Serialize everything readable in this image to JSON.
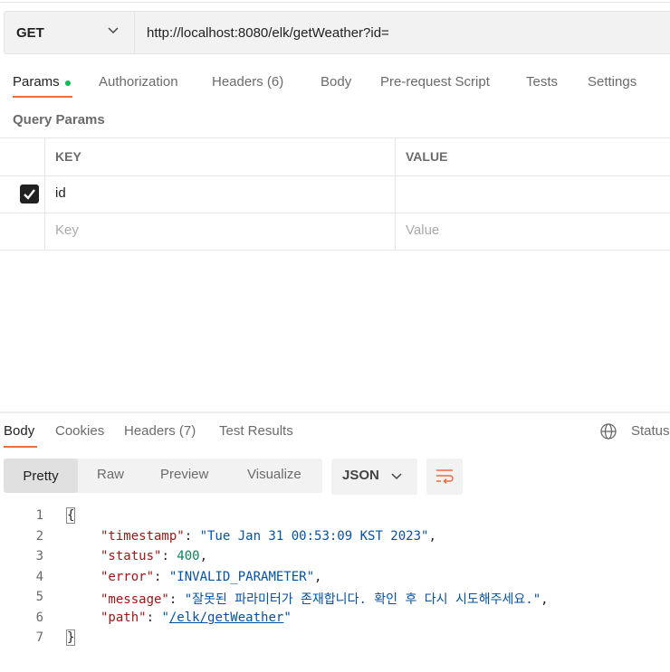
{
  "request": {
    "method": "GET",
    "url": "http://localhost:8080/elk/getWeather?id="
  },
  "request_tabs": [
    {
      "label": "Params"
    },
    {
      "label": "Authorization"
    },
    {
      "label": "Headers (6)"
    },
    {
      "label": "Body"
    },
    {
      "label": "Pre-request Script"
    },
    {
      "label": "Tests"
    },
    {
      "label": "Settings"
    }
  ],
  "query_params": {
    "title": "Query Params",
    "columns": [
      "KEY",
      "VALUE"
    ],
    "rows": [
      {
        "checked": true,
        "key": "id",
        "value": ""
      }
    ],
    "placeholder_key": "Key",
    "placeholder_value": "Value"
  },
  "response_tabs": [
    {
      "label": "Body"
    },
    {
      "label": "Cookies"
    },
    {
      "label": "Headers (7)"
    },
    {
      "label": "Test Results"
    }
  ],
  "status_label": "Status",
  "view_modes": [
    "Pretty",
    "Raw",
    "Preview",
    "Visualize"
  ],
  "format": "JSON",
  "code": {
    "line_numbers": [
      "1",
      "2",
      "3",
      "4",
      "5",
      "6",
      "7"
    ],
    "open_brace": "{",
    "close_brace": "}",
    "fields": [
      {
        "key": "\"timestamp\"",
        "value": "\"Tue Jan 31 00:53:09 KST 2023\"",
        "type": "string"
      },
      {
        "key": "\"status\"",
        "value": "400",
        "type": "number"
      },
      {
        "key": "\"error\"",
        "value": "\"INVALID_PARAMETER\"",
        "type": "string"
      },
      {
        "key": "\"message\"",
        "value": "\"잘못된 파라미터가 존재합니다. 확인 후 다시 시도해주세요.\"",
        "type": "string"
      },
      {
        "key": "\"path\"",
        "value_prefix": "\"",
        "value_link": "/elk/getWeather",
        "value_suffix": "\"",
        "type": "link"
      }
    ]
  },
  "colors": {
    "accent": "#f26b3a",
    "active_dot": "#0cbb52",
    "json_key": "#a31515",
    "json_string": "#0451a5",
    "json_number": "#098658"
  },
  "icons": [
    "chevron-down-icon",
    "checkbox-checked-icon",
    "globe-icon",
    "wrap-lines-icon"
  ]
}
